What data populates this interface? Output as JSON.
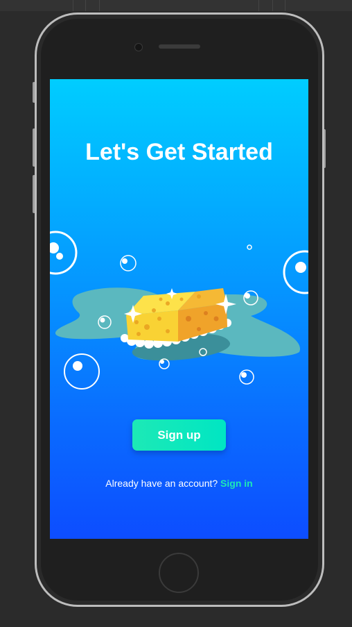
{
  "screen": {
    "title": "Let's Get Started",
    "signup_label": "Sign up",
    "account_prompt": "Already have an account?",
    "signin_label": "Sign in"
  },
  "colors": {
    "gradient_top": "#00cdff",
    "gradient_bottom": "#0d4dff",
    "accent": "#1de9b6"
  },
  "illustration": {
    "icon": "sponge-illustration"
  }
}
